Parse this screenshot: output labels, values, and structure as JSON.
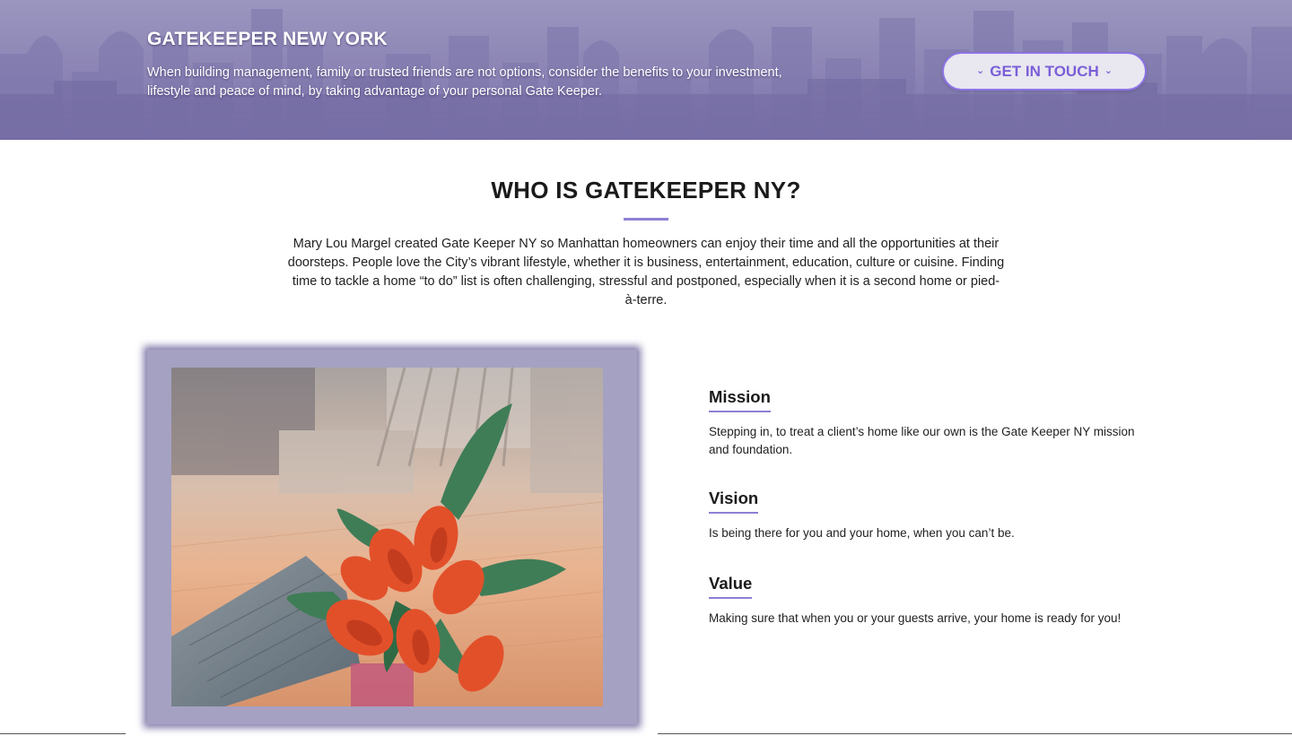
{
  "hero": {
    "title": "GATEKEEPER NEW YORK",
    "text": "When building management, family or trusted friends are not options, consider the benefits to your investment, lifestyle and peace of mind, by taking advantage of your personal Gate Keeper.",
    "cta_label": "GET IN TOUCH",
    "cta_icon": "chevron-down-icon"
  },
  "about": {
    "title": "WHO IS GATEKEEPER NY?",
    "text": "Mary Lou Margel created Gate Keeper NY so Manhattan homeowners can enjoy their time and all the opportunities at their doorsteps. People love the City’s vibrant lifestyle, whether it is business, entertainment, education, culture or cuisine. Finding time to tackle a home “to do” list is often challenging, stressful and postponed, especially when it is a second home or pied-à-terre."
  },
  "features": [
    {
      "title": "Mission",
      "text": "Stepping in, to treat a client’s home like our own is the Gate Keeper NY mission and foundation."
    },
    {
      "title": "Vision",
      "text": "Is being there for you and your home, when you can’t be."
    },
    {
      "title": "Value",
      "text": "Making sure that when you or your guests arrive, your home is ready for you!"
    }
  ],
  "colors": {
    "accent": "#8e7fd6",
    "hero_bg": "#8a83b4",
    "button_text": "#7a5fd8",
    "frame": "#a5a1c2"
  }
}
